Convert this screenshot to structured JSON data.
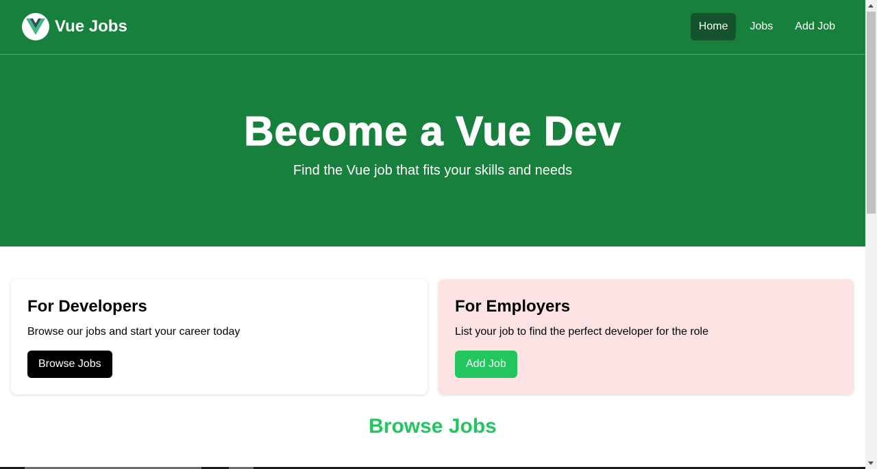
{
  "navbar": {
    "brand": "Vue Jobs",
    "logo_icon": "vue-logo-icon",
    "links": [
      {
        "label": "Home",
        "active": true
      },
      {
        "label": "Jobs",
        "active": false
      },
      {
        "label": "Add Job",
        "active": false
      }
    ]
  },
  "hero": {
    "title": "Become a Vue Dev",
    "subtitle": "Find the Vue job that fits your skills and needs"
  },
  "cards": {
    "developers": {
      "title": "For Developers",
      "text": "Browse our jobs and start your career today",
      "button": "Browse Jobs"
    },
    "employers": {
      "title": "For Employers",
      "text": "List your job to find the perfect developer for the role",
      "button": "Add Job"
    }
  },
  "section": {
    "title": "Browse Jobs"
  },
  "colors": {
    "primary_green": "#16803c",
    "accent_green": "#22c55e",
    "active_nav": "#14532d",
    "employer_card_bg": "#fde2e4"
  }
}
